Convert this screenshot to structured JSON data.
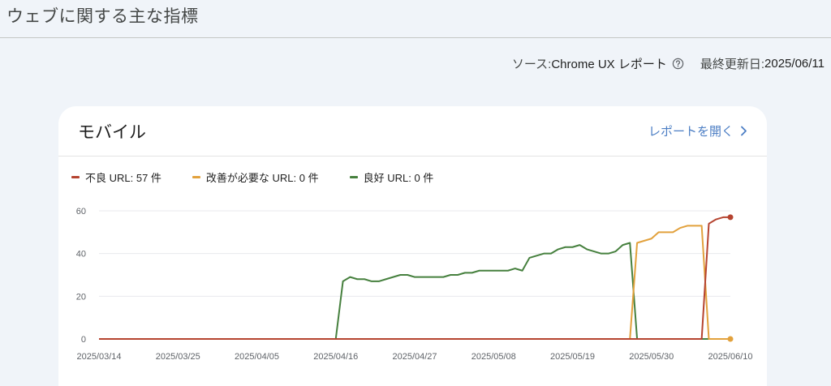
{
  "page": {
    "title": "ウェブに関する主な指標"
  },
  "meta": {
    "source_label": "ソース: ",
    "source_value": "Chrome UX レポート",
    "updated_label": "最終更新日: ",
    "updated_value": "2025/06/11",
    "help_icon": "help-circle-icon"
  },
  "card": {
    "title": "モバイル",
    "open_report_label": "レポートを開く",
    "open_report_icon": "chevron-right-icon"
  },
  "legend": [
    {
      "label": "不良 URL: 57 件",
      "color": "#b5432f"
    },
    {
      "label": "改善が必要な URL: 0 件",
      "color": "#e2a13c"
    },
    {
      "label": "良好 URL: 0 件",
      "color": "#46803e"
    }
  ],
  "chart_data": {
    "type": "line",
    "ylim": [
      0,
      60
    ],
    "yticks": [
      0,
      20,
      40,
      60
    ],
    "xticks": [
      "2025/03/14",
      "2025/03/25",
      "2025/04/05",
      "2025/04/16",
      "2025/04/27",
      "2025/05/08",
      "2025/05/19",
      "2025/05/30",
      "2025/06/10"
    ],
    "x_start": "2025/03/14",
    "x_end": "2025/06/10",
    "series": [
      {
        "name": "良好 URL: 0 件",
        "color": "#46803e",
        "points": [
          [
            "2025/03/14",
            0
          ],
          [
            "2025/04/16",
            0
          ],
          [
            "2025/04/17",
            27
          ],
          [
            "2025/04/18",
            29
          ],
          [
            "2025/04/19",
            28
          ],
          [
            "2025/04/20",
            28
          ],
          [
            "2025/04/21",
            27
          ],
          [
            "2025/04/22",
            27
          ],
          [
            "2025/04/23",
            28
          ],
          [
            "2025/04/24",
            29
          ],
          [
            "2025/04/25",
            30
          ],
          [
            "2025/04/26",
            30
          ],
          [
            "2025/04/27",
            29
          ],
          [
            "2025/04/28",
            29
          ],
          [
            "2025/04/29",
            29
          ],
          [
            "2025/04/30",
            29
          ],
          [
            "2025/05/01",
            29
          ],
          [
            "2025/05/02",
            30
          ],
          [
            "2025/05/03",
            30
          ],
          [
            "2025/05/04",
            31
          ],
          [
            "2025/05/05",
            31
          ],
          [
            "2025/05/06",
            32
          ],
          [
            "2025/05/07",
            32
          ],
          [
            "2025/05/08",
            32
          ],
          [
            "2025/05/09",
            32
          ],
          [
            "2025/05/10",
            32
          ],
          [
            "2025/05/11",
            33
          ],
          [
            "2025/05/12",
            32
          ],
          [
            "2025/05/13",
            38
          ],
          [
            "2025/05/14",
            39
          ],
          [
            "2025/05/15",
            40
          ],
          [
            "2025/05/16",
            40
          ],
          [
            "2025/05/17",
            42
          ],
          [
            "2025/05/18",
            43
          ],
          [
            "2025/05/19",
            43
          ],
          [
            "2025/05/20",
            44
          ],
          [
            "2025/05/21",
            42
          ],
          [
            "2025/05/22",
            41
          ],
          [
            "2025/05/23",
            40
          ],
          [
            "2025/05/24",
            40
          ],
          [
            "2025/05/25",
            41
          ],
          [
            "2025/05/26",
            44
          ],
          [
            "2025/05/27",
            45
          ],
          [
            "2025/05/28",
            0
          ],
          [
            "2025/06/10",
            0
          ]
        ]
      },
      {
        "name": "改善が必要な URL: 0 件",
        "color": "#e2a13c",
        "points": [
          [
            "2025/03/14",
            0
          ],
          [
            "2025/05/27",
            0
          ],
          [
            "2025/05/28",
            45
          ],
          [
            "2025/05/29",
            46
          ],
          [
            "2025/05/30",
            47
          ],
          [
            "2025/05/31",
            50
          ],
          [
            "2025/06/01",
            50
          ],
          [
            "2025/06/02",
            50
          ],
          [
            "2025/06/03",
            52
          ],
          [
            "2025/06/04",
            53
          ],
          [
            "2025/06/05",
            53
          ],
          [
            "2025/06/06",
            53
          ],
          [
            "2025/06/07",
            0
          ],
          [
            "2025/06/10",
            0
          ]
        ]
      },
      {
        "name": "不良 URL: 57 件",
        "color": "#b5432f",
        "points": [
          [
            "2025/03/14",
            0
          ],
          [
            "2025/06/06",
            0
          ],
          [
            "2025/06/07",
            54
          ],
          [
            "2025/06/08",
            56
          ],
          [
            "2025/06/09",
            57
          ],
          [
            "2025/06/10",
            57
          ]
        ]
      }
    ]
  }
}
